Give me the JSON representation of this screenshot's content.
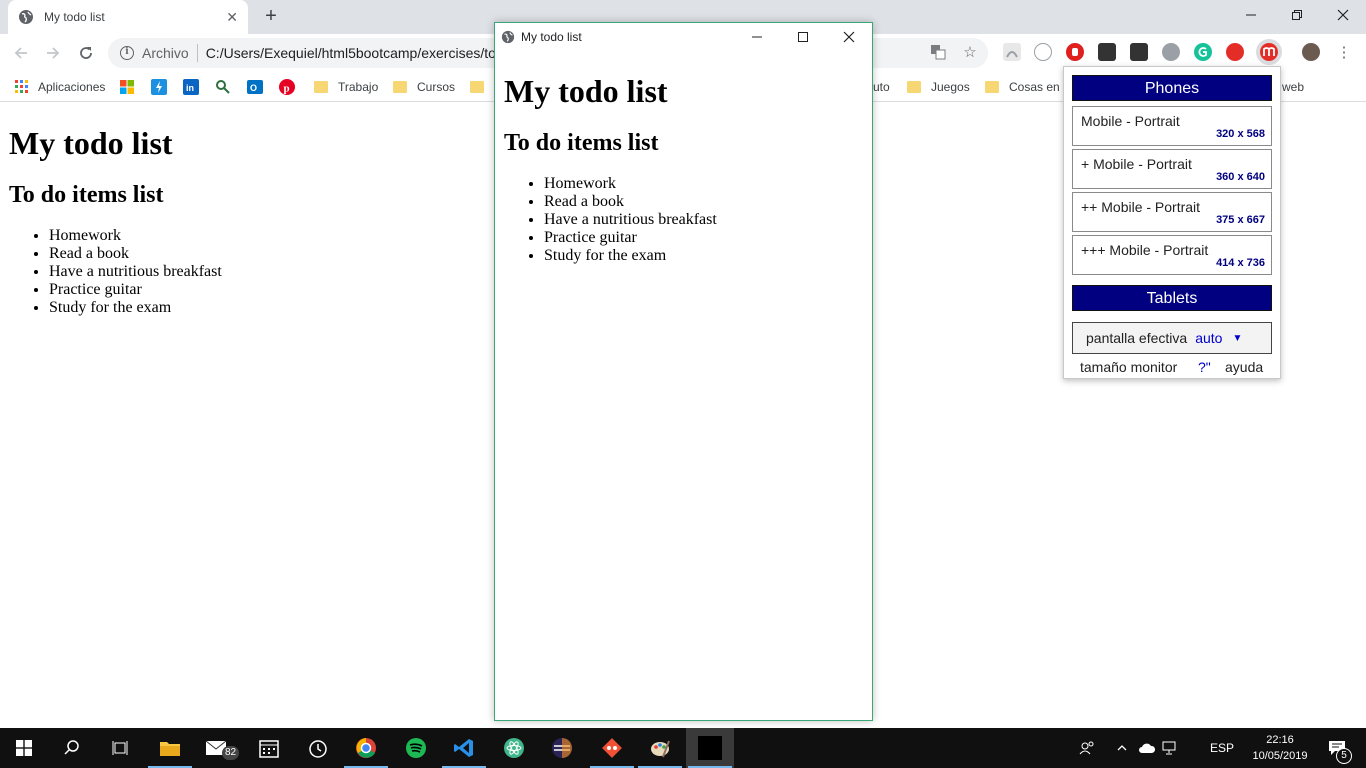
{
  "browser": {
    "tab_title": "My todo list",
    "omnibox_scheme": "Archivo",
    "omnibox_url": "C:/Users/Exequiel/html5bootcamp/exercises/to"
  },
  "bookmarks": [
    {
      "label": "Aplicaciones",
      "kind": "apps"
    },
    {
      "label": "Trabajo",
      "kind": "folder"
    },
    {
      "label": "Cursos",
      "kind": "folder"
    },
    {
      "label": "uto",
      "kind": "folder-partial"
    },
    {
      "label": "Juegos",
      "kind": "folder"
    },
    {
      "label": "Cosas en g",
      "kind": "folder"
    },
    {
      "label": "web",
      "kind": "folder-partial"
    }
  ],
  "page": {
    "heading": "My todo list",
    "subheading": "To do items list",
    "items": [
      "Homework",
      "Read a book",
      "Have a nutritious breakfast",
      "Practice guitar",
      "Study for the exam"
    ]
  },
  "popup": {
    "title": "My todo list"
  },
  "resolution_panel": {
    "phones_header": "Phones",
    "devices": [
      {
        "name": "Mobile - Portrait",
        "size": "320 x 568"
      },
      {
        "name": "+ Mobile - Portrait",
        "size": "360 x 640"
      },
      {
        "name": "++ Mobile - Portrait",
        "size": "375 x 667"
      },
      {
        "name": "+++ Mobile - Portrait",
        "size": "414 x 736"
      }
    ],
    "tablets_header": "Tablets",
    "effective_label": "pantalla efectiva",
    "effective_value": "auto",
    "monitor_label": "tamaño monitor",
    "monitor_value": "?\"",
    "help_label": "ayuda"
  },
  "taskbar": {
    "mail_badge": "82",
    "language": "ESP",
    "time": "22:16",
    "date": "10/05/2019",
    "notifications": "5"
  },
  "colors": {
    "panel_header": "#000080",
    "popup_border": "#3aa776",
    "taskbar": "#101010"
  }
}
